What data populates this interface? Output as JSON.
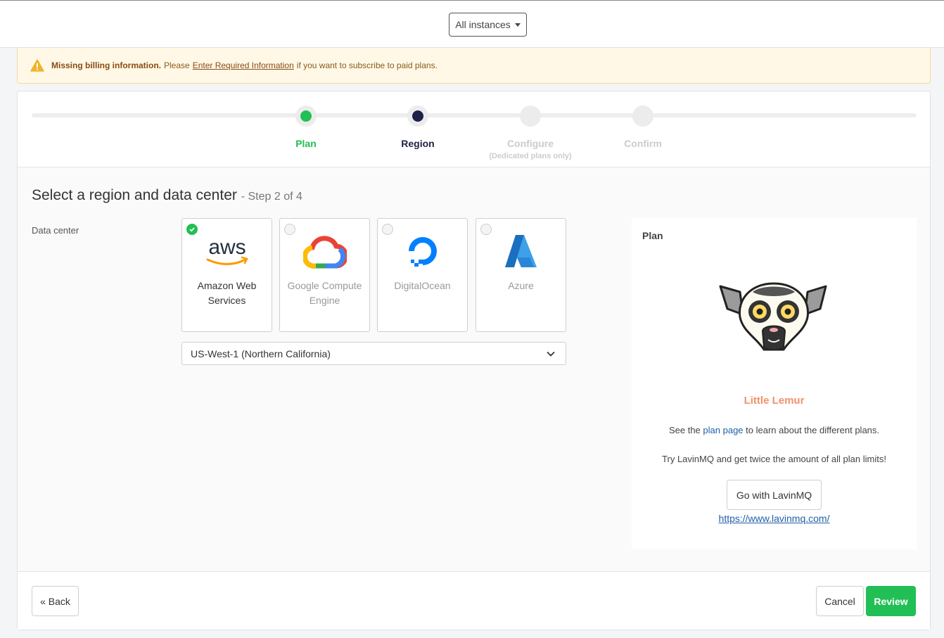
{
  "topbar": {
    "instances_label": "All instances"
  },
  "alert": {
    "bold": "Missing billing information.",
    "pre": "Please",
    "link": "Enter Required Information",
    "post": "if you want to subscribe to paid plans."
  },
  "steps": [
    {
      "label": "Plan",
      "sub": "",
      "state": "done",
      "color": "#21bf55"
    },
    {
      "label": "Region",
      "sub": "",
      "state": "current",
      "color": "#1e2246"
    },
    {
      "label": "Configure",
      "sub": "(Dedicated plans only)",
      "state": "pending",
      "color": "#cccccc"
    },
    {
      "label": "Confirm",
      "sub": "",
      "state": "pending",
      "color": "#cccccc"
    }
  ],
  "main": {
    "title": "Select a region and data center",
    "title_step": "- Step 2 of 4",
    "data_center_label": "Data center"
  },
  "providers": [
    {
      "name": "Amazon Web Services",
      "icon": "aws-logo-icon",
      "selected": true
    },
    {
      "name": "Google Compute Engine",
      "icon": "google-cloud-logo-icon",
      "selected": false
    },
    {
      "name": "DigitalOcean",
      "icon": "digitalocean-logo-icon",
      "selected": false
    },
    {
      "name": "Azure",
      "icon": "azure-logo-icon",
      "selected": false
    }
  ],
  "region_select": {
    "value": "US-West-1 (Northern California)"
  },
  "plan_panel": {
    "heading": "Plan",
    "plan_name": "Little Lemur",
    "info_pre": "See the",
    "info_link": "plan page",
    "info_post": "to learn about the different plans.",
    "promo": "Try LavinMQ and get twice the amount of all plan limits!",
    "button": "Go with LavinMQ",
    "url": "https://www.lavinmq.com/"
  },
  "footer": {
    "back": "« Back",
    "cancel": "Cancel",
    "review": "Review"
  },
  "colors": {
    "accent_green": "#21bf55",
    "plan_name": "#f0926a",
    "link": "#1f5fa8",
    "warning_bg": "#fff8e6"
  }
}
